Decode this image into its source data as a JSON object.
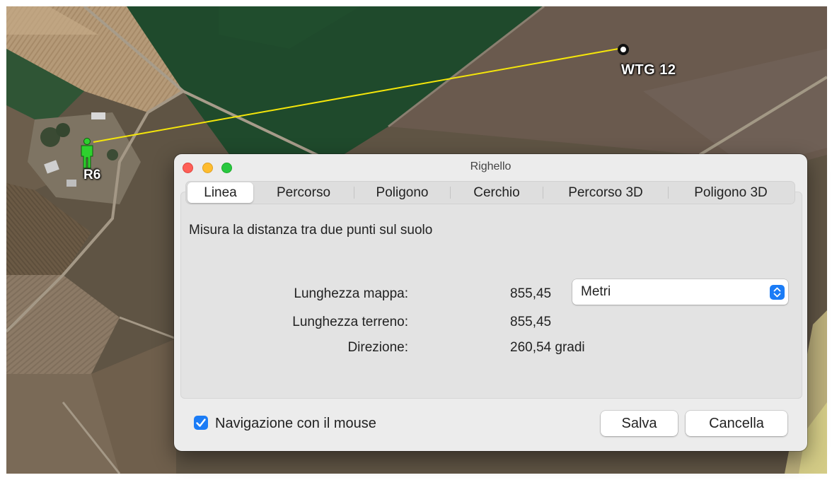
{
  "map": {
    "markers": [
      {
        "id": "wtg",
        "label": "WTG 12",
        "icon": "target-marker-icon"
      },
      {
        "id": "r6",
        "label": "R6",
        "icon": "person-marker-icon"
      }
    ],
    "line_color": "#f5e60a"
  },
  "dialog": {
    "title": "Righello",
    "tabs": [
      {
        "label": "Linea",
        "selected": true
      },
      {
        "label": "Percorso",
        "selected": false
      },
      {
        "label": "Poligono",
        "selected": false
      },
      {
        "label": "Cerchio",
        "selected": false
      },
      {
        "label": "Percorso 3D",
        "selected": false
      },
      {
        "label": "Poligono 3D",
        "selected": false
      }
    ],
    "subtitle": "Misura la distanza tra due punti sul suolo",
    "map_length_label": "Lunghezza mappa:",
    "map_length_value": "855,45",
    "ground_length_label": "Lunghezza terreno:",
    "ground_length_value": "855,45",
    "direction_label": "Direzione:",
    "direction_value": "260,54 gradi",
    "units_selected": "Metri",
    "mouse_nav_label": "Navigazione con il mouse",
    "mouse_nav_checked": true,
    "save_label": "Salva",
    "cancel_label": "Cancella",
    "accent_color": "#1b7cf6"
  }
}
